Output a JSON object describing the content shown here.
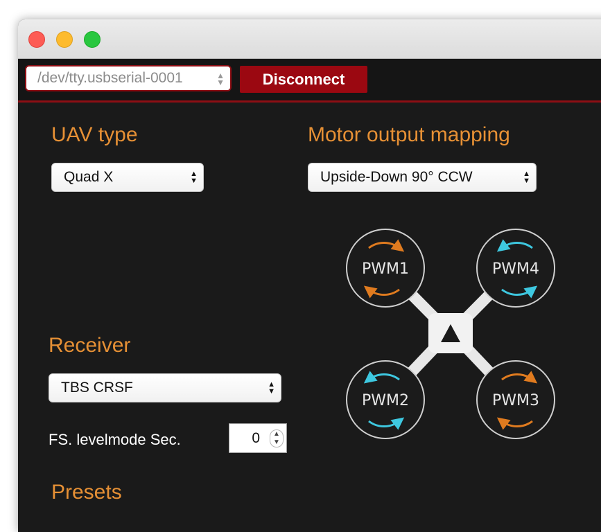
{
  "window": {
    "traffic_lights": [
      "close",
      "minimize",
      "zoom"
    ]
  },
  "toolbar": {
    "port_value": "/dev/tty.usbserial-0001",
    "disconnect_label": "Disconnect"
  },
  "uav": {
    "heading": "UAV type",
    "selected": "Quad X"
  },
  "motor_mapping": {
    "heading": "Motor output mapping",
    "selected": "Upside-Down 90° CCW",
    "motors": [
      {
        "label": "PWM1",
        "arrow_color": "#e07b1f"
      },
      {
        "label": "PWM4",
        "arrow_color": "#3ec8e0"
      },
      {
        "label": "PWM2",
        "arrow_color": "#3ec8e0"
      },
      {
        "label": "PWM3",
        "arrow_color": "#e07b1f"
      }
    ]
  },
  "receiver": {
    "heading": "Receiver",
    "selected": "TBS CRSF",
    "fs_label": "FS. levelmode Sec.",
    "fs_value": "0"
  },
  "presets": {
    "heading": "Presets"
  },
  "colors": {
    "accent": "#e69035",
    "brand_red": "#9b0811",
    "background": "#1a1a1a"
  }
}
